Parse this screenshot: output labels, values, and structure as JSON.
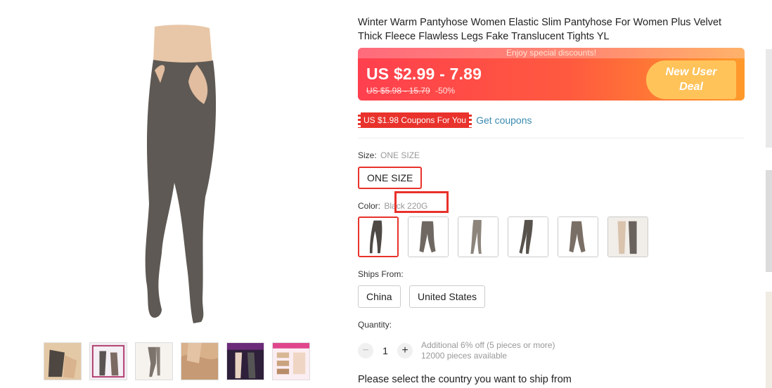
{
  "product": {
    "title": "Winter Warm Pantyhose Women Elastic Slim Pantyhose For Women Plus Velvet Thick Fleece Flawless Legs Fake Translucent Tights YL"
  },
  "price": {
    "promo": "Enjoy special discounts!",
    "current": "US $2.99 - 7.89",
    "original": "US $5.98 - 15.79",
    "discount": "-50%",
    "badge_line1": "New User",
    "badge_line2": "Deal"
  },
  "coupon": {
    "tag": "US $1.98 Coupons For You",
    "link": "Get coupons"
  },
  "size": {
    "label": "Size:",
    "value": "ONE SIZE",
    "options": [
      "ONE SIZE"
    ]
  },
  "color": {
    "label": "Color:",
    "value": "Black 220G",
    "swatch_count": 6
  },
  "ships_from": {
    "label": "Ships From:",
    "options": [
      "China",
      "United States"
    ]
  },
  "quantity": {
    "label": "Quantity:",
    "minus": "−",
    "value": "1",
    "plus": "+",
    "info_line1": "Additional 6% off (5 pieces or more)",
    "info_line2": "12000 pieces available"
  },
  "shipping_note": "Please select the country you want to ship from",
  "colors": {
    "accent": "#e8322b",
    "price_gradient_start": "#ff3f4e",
    "price_gradient_end": "#ff9a2a",
    "link": "#3a8ab0",
    "tights": "#5e5954"
  }
}
